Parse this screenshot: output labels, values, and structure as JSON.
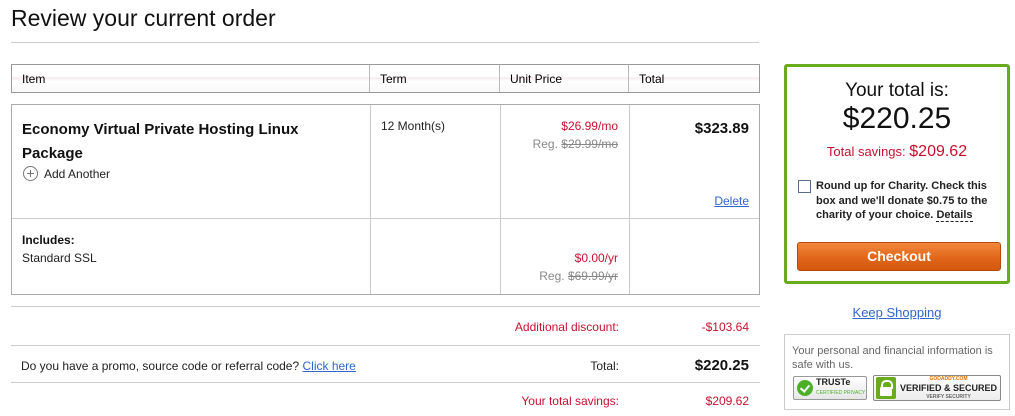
{
  "page_title": "Review your current order",
  "table_headers": {
    "item": "Item",
    "term": "Term",
    "unit_price": "Unit Price",
    "total": "Total"
  },
  "line_item": {
    "name": "Economy Virtual Private Hosting Linux Package",
    "add_another": "Add Another",
    "term": "12 Month(s)",
    "price": "$26.99/mo",
    "reg_label": "Reg.",
    "reg_price": "$29.99/mo",
    "total": "$323.89",
    "delete": "Delete"
  },
  "includes": {
    "label": "Includes:",
    "item": "Standard SSL",
    "price": "$0.00/yr",
    "reg_label": "Reg.",
    "reg_price": "$69.99/yr"
  },
  "summary": {
    "discount_label": "Additional discount:",
    "discount_value": "-$103.64",
    "promo_text": "Do you have a promo, source code or referral code?",
    "promo_link": "Click here",
    "total_label": "Total:",
    "total_value": "$220.25",
    "savings_label": "Your total savings:",
    "savings_value": "$209.62"
  },
  "total_box": {
    "heading": "Your total is:",
    "grand_total": "$220.25",
    "savings_label": "Total savings:",
    "savings_value": "$209.62",
    "charity_text": "Round up for Charity. Check this box and we'll donate $0.75 to the charity of your choice.",
    "charity_details": "Details",
    "charity_checked": false,
    "checkout_label": "Checkout"
  },
  "keep_shopping": "Keep Shopping",
  "security": {
    "text": "Your personal and financial information is safe with us.",
    "truste_label": "TRUSTe",
    "truste_sub": "CERTIFIED PRIVACY",
    "verified_top": "GODADDY.COM",
    "verified_label": "VERIFIED & SECURED",
    "verified_sub": "VERIFY SECURITY"
  },
  "colors": {
    "accent_red": "#c8102e",
    "link_blue": "#3366cc",
    "checkout_orange": "#e0661a",
    "box_green": "#6aaa1e"
  }
}
